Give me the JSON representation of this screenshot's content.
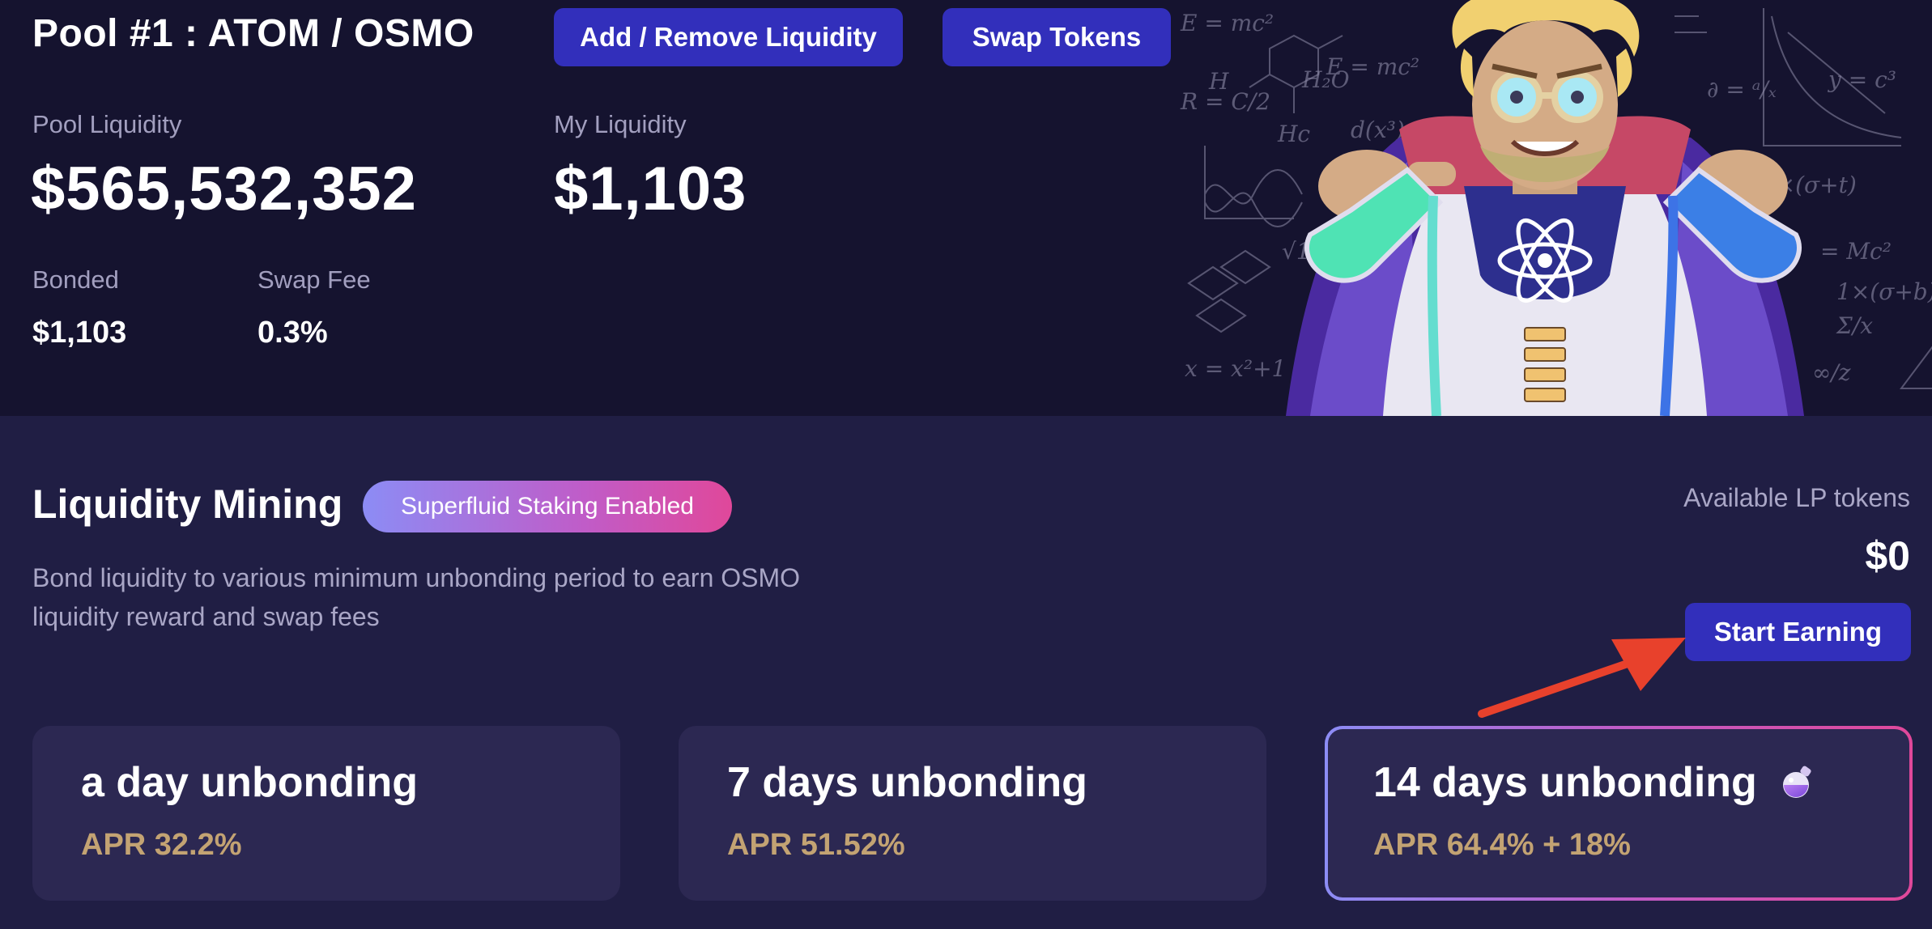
{
  "pool": {
    "title": "Pool #1 : ATOM / OSMO",
    "add_remove_label": "Add / Remove Liquidity",
    "swap_label": "Swap Tokens",
    "pool_liquidity_label": "Pool Liquidity",
    "pool_liquidity_value": "$565,532,352",
    "my_liquidity_label": "My Liquidity",
    "my_liquidity_value": "$1,103",
    "bonded_label": "Bonded",
    "bonded_value": "$1,103",
    "swap_fee_label": "Swap Fee",
    "swap_fee_value": "0.3%"
  },
  "mining": {
    "title": "Liquidity Mining",
    "badge": "Superfluid Staking Enabled",
    "description": "Bond liquidity to various minimum unbonding period to earn OSMO liquidity reward and swap fees",
    "available_lp_label": "Available LP tokens",
    "available_lp_value": "$0",
    "start_earning_label": "Start Earning"
  },
  "cards": [
    {
      "title": "a day unbonding",
      "apr": "APR 32.2%"
    },
    {
      "title": "7 days unbonding",
      "apr": "APR 51.52%"
    },
    {
      "title": "14 days unbonding",
      "apr": "APR 64.4% + 18%",
      "icon": "potion-icon"
    }
  ],
  "colors": {
    "header_bg": "#15132f",
    "page_bg": "#201e44",
    "card_bg": "#2c2852",
    "button": "#322fbb",
    "apr_text": "#c3a373",
    "annotation_arrow": "#e8412c"
  }
}
